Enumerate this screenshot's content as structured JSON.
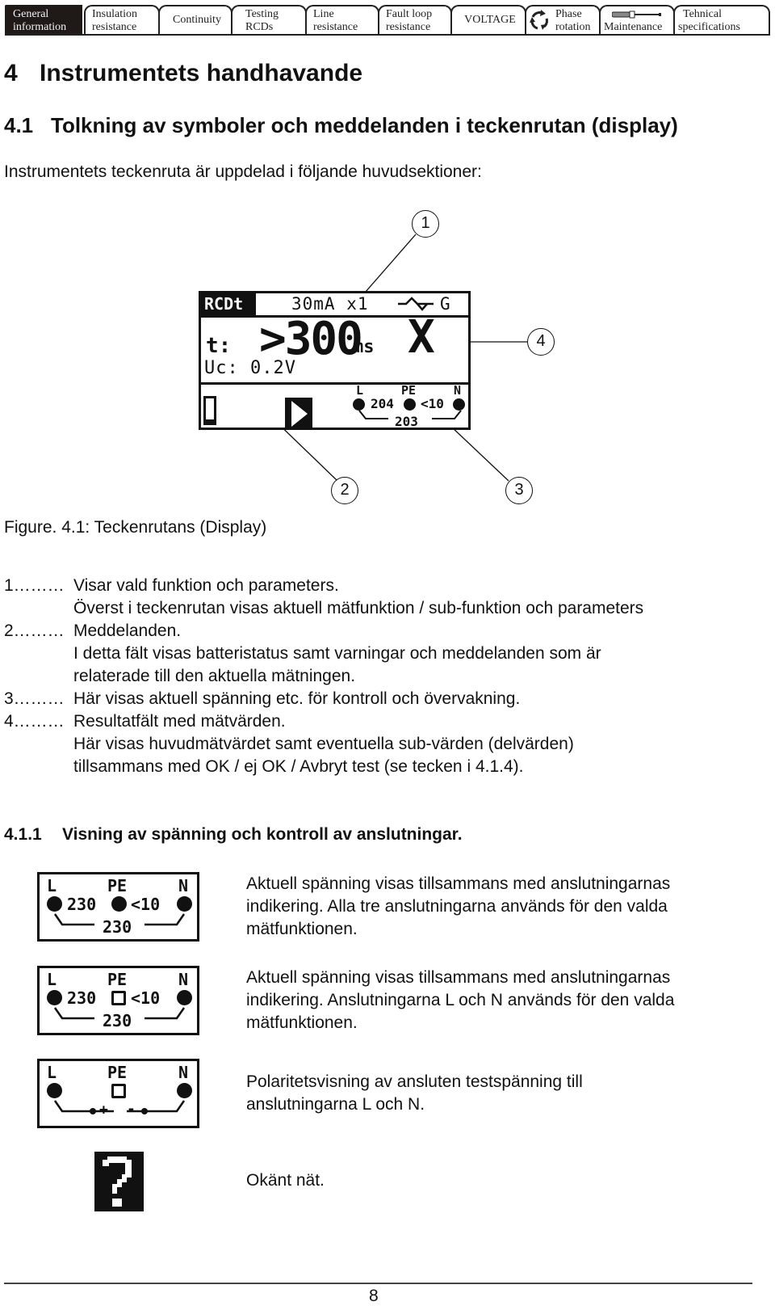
{
  "tabs": [
    {
      "line1": "General",
      "line2": "information",
      "active": true
    },
    {
      "line1": "Insulation",
      "line2": "resistance",
      "active": false
    },
    {
      "line1": "Continuity",
      "line2": "",
      "active": false
    },
    {
      "line1": "Testing",
      "line2": "RCDs",
      "active": false
    },
    {
      "line1": "Line",
      "line2": "resistance",
      "active": false
    },
    {
      "line1": "Fault loop",
      "line2": "resistance",
      "active": false
    },
    {
      "line1": "VOLTAGE",
      "line2": "",
      "active": false
    },
    {
      "line1": "Phase",
      "line2": "rotation",
      "icon": "phase-rotation-icon",
      "active": false
    },
    {
      "line1": "",
      "line2": "Maintenance",
      "icon": "screwdriver-icon",
      "active": false
    },
    {
      "line1": "Tehnical",
      "line2": "specifications",
      "active": false
    }
  ],
  "heading1": {
    "number": "4",
    "text": "Instrumentets handhavande"
  },
  "heading2": {
    "number": "4.1",
    "text": "Tolkning av symboler och meddelanden i teckenrutan (display)"
  },
  "intro": "Instrumentets teckenruta är uppdelad i följande huvudsektioner:",
  "figure": {
    "callouts": [
      "1",
      "2",
      "3",
      "4"
    ],
    "lcd": {
      "function": "RCDt",
      "params": "30mA x1",
      "wave_icon": "ac-waveform-icon",
      "type": "G",
      "t_label": "t:",
      "value": ">300",
      "unit": "ms",
      "result_symbol": "X",
      "uc": "Uc: 0.2V",
      "terminals": {
        "L": "L",
        "PE": "PE",
        "N": "N"
      },
      "v_l_pe": "204",
      "v_pe_n": "<10",
      "v_l_n": "203"
    },
    "caption": "Figure. 4.1: Teckenrutans (Display)"
  },
  "list": [
    {
      "num": "1………",
      "title": "Visar vald funktion och parameters.",
      "body": [
        "Överst i teckenrutan visas aktuell mätfunktion / sub-funktion och parameters"
      ]
    },
    {
      "num": "2………",
      "title": "Meddelanden.",
      "body": [
        "I detta fält visas batteristatus samt varningar och meddelanden som är",
        "relaterade till den aktuella mätningen."
      ]
    },
    {
      "num": "3………",
      "title": "Här visas aktuell spänning etc. för kontroll och övervakning.",
      "body": []
    },
    {
      "num": "4………",
      "title": "Resultatfält med mätvärden.",
      "body": [
        "Här visas huvudmätvärdet samt eventuella sub-värden (delvärden)",
        "tillsammans med OK / ej OK / Avbryt test (se tecken i 4.1.4)."
      ]
    }
  ],
  "heading3": {
    "number": "4.1.1",
    "text": "Visning av spänning och kontroll av anslutningar."
  },
  "indicators": [
    {
      "L": "L",
      "PE": "PE",
      "N": "N",
      "v_l_pe": "230",
      "v_pe_n": "<10",
      "v_l_n": "230",
      "pe_state": "filled",
      "description": [
        "Aktuell spänning visas tillsammans med anslutningarnas",
        "indikering. Alla tre anslutningarna används för den valda",
        "mätfunktionen."
      ]
    },
    {
      "L": "L",
      "PE": "PE",
      "N": "N",
      "v_l_pe": "230",
      "v_pe_n": "<10",
      "v_l_n": "230",
      "pe_state": "open",
      "description": [
        "Aktuell spänning visas tillsammans med anslutningarnas",
        "indikering. Anslutningarna L och N används för den valda",
        "mätfunktionen."
      ]
    },
    {
      "L": "L",
      "PE": "PE",
      "N": "N",
      "plus": "+",
      "minus": "-",
      "pe_state": "open",
      "description": [
        "Polaritetsvisning av ansluten testspänning till",
        "anslutningarna L och N."
      ]
    },
    {
      "icon": "unknown-network-icon",
      "glyph": "?",
      "description": [
        "Okänt nät."
      ]
    }
  ],
  "page_number": "8"
}
